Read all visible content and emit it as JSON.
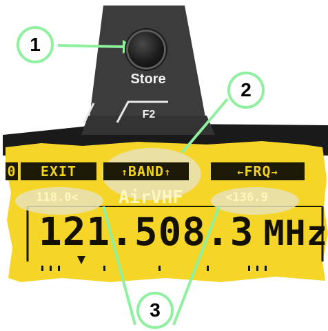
{
  "device": {
    "store_button_label": "Store",
    "f2_label": "F2"
  },
  "display": {
    "softkeys": {
      "left_fragment": "0",
      "exit": "EXIT",
      "band": "BAND",
      "band_arrow_left": "↑",
      "band_arrow_right": "↑",
      "frq": "FRQ",
      "frq_arrow_left": "←",
      "frq_arrow_right": "→"
    },
    "band_row": {
      "lower_limit": "118.0",
      "lower_arrow": "<",
      "band_name": "AirVHF",
      "upper_arrow": "<",
      "upper_limit": "136.9"
    },
    "frequency": {
      "value": "121.508.3",
      "unit": "MHz"
    }
  },
  "callouts": {
    "c1": "1",
    "c2": "2",
    "c3": "3"
  },
  "colors": {
    "lcd_background": "#f5d628",
    "housing": "#3c3c3c",
    "highlight": "#e7e2b8",
    "callout_border": "#8ff0a0"
  }
}
